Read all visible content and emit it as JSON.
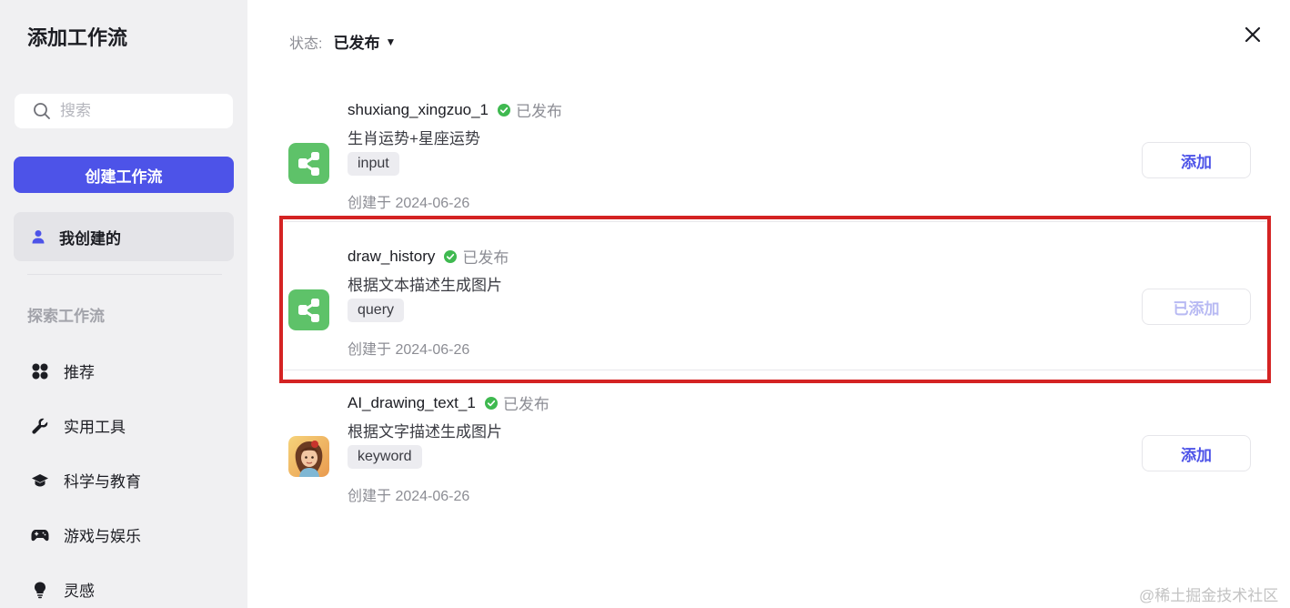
{
  "sidebar": {
    "title": "添加工作流",
    "search_placeholder": "搜索",
    "create_button": "创建工作流",
    "mine_label": "我创建的",
    "explore_label": "探索工作流",
    "categories": [
      {
        "label": "推荐",
        "icon": "grid-icon"
      },
      {
        "label": "实用工具",
        "icon": "wrench-icon"
      },
      {
        "label": "科学与教育",
        "icon": "graduation-cap-icon"
      },
      {
        "label": "游戏与娱乐",
        "icon": "gamepad-icon"
      },
      {
        "label": "灵感",
        "icon": "lightbulb-icon"
      }
    ]
  },
  "main": {
    "status_label": "状态:",
    "status_value": "已发布",
    "workflows": [
      {
        "name": "shuxiang_xingzuo_1",
        "status": "已发布",
        "description": "生肖运势+星座运势",
        "tag": "input",
        "created": "创建于 2024-06-26",
        "button": "添加",
        "icon": "workflow-icon"
      },
      {
        "name": "draw_history",
        "status": "已发布",
        "description": "根据文本描述生成图片",
        "tag": "query",
        "created": "创建于 2024-06-26",
        "button": "已添加",
        "icon": "workflow-icon"
      },
      {
        "name": "AI_drawing_text_1",
        "status": "已发布",
        "description": "根据文字描述生成图片",
        "tag": "keyword",
        "created": "创建于 2024-06-26",
        "button": "添加",
        "icon": "portrait-avatar-icon"
      }
    ]
  },
  "watermark": "@稀土掘金技术社区",
  "colors": {
    "accent": "#4d53e8",
    "success": "#3fb950",
    "workflow_icon_bg": "#5ec269",
    "highlight_border": "#d42323"
  }
}
